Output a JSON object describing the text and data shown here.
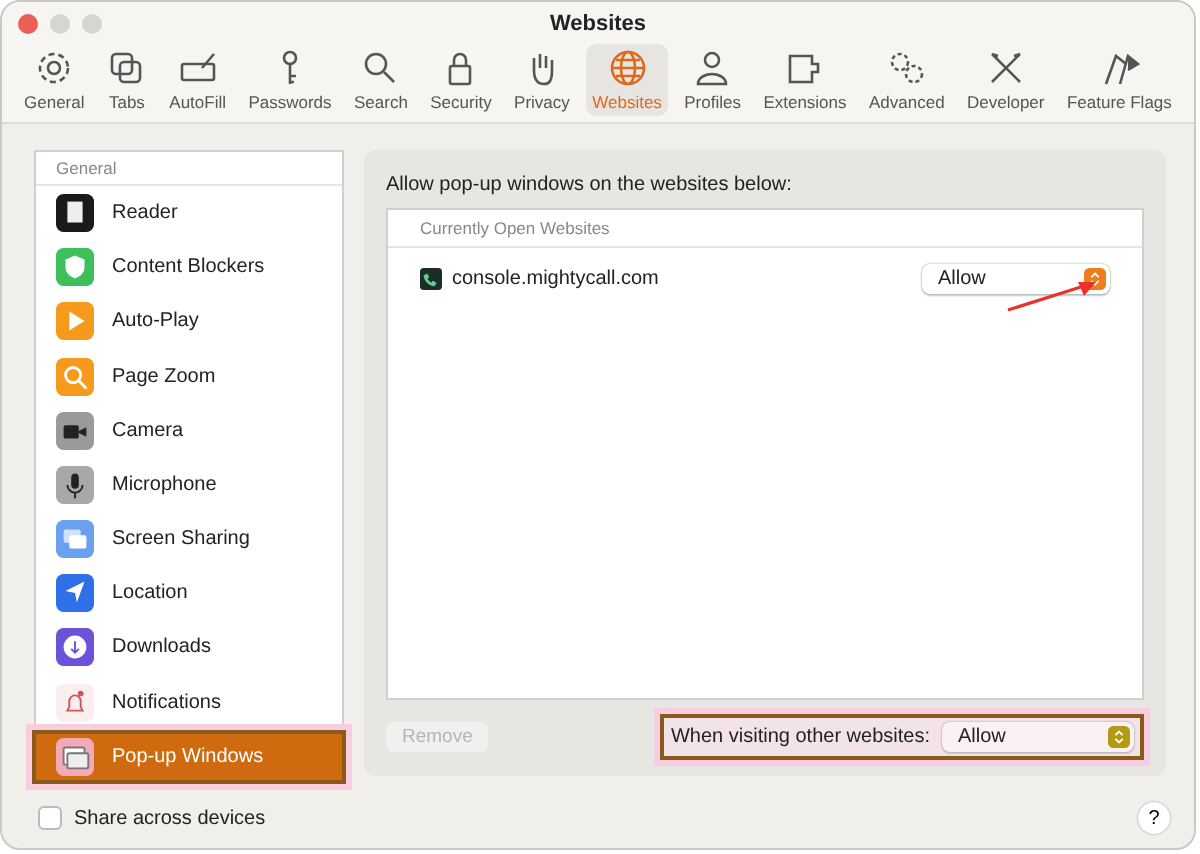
{
  "window": {
    "title": "Websites"
  },
  "toolbar": [
    {
      "label": "General",
      "selected": false
    },
    {
      "label": "Tabs",
      "selected": false
    },
    {
      "label": "AutoFill",
      "selected": false
    },
    {
      "label": "Passwords",
      "selected": false
    },
    {
      "label": "Search",
      "selected": false
    },
    {
      "label": "Security",
      "selected": false
    },
    {
      "label": "Privacy",
      "selected": false
    },
    {
      "label": "Websites",
      "selected": true
    },
    {
      "label": "Profiles",
      "selected": false
    },
    {
      "label": "Extensions",
      "selected": false
    },
    {
      "label": "Advanced",
      "selected": false
    },
    {
      "label": "Developer",
      "selected": false
    },
    {
      "label": "Feature Flags",
      "selected": false
    }
  ],
  "sidebar": {
    "header": "General",
    "items": [
      {
        "label": "Reader",
        "selected": false
      },
      {
        "label": "Content Blockers",
        "selected": false
      },
      {
        "label": "Auto-Play",
        "selected": false
      },
      {
        "label": "Page Zoom",
        "selected": false
      },
      {
        "label": "Camera",
        "selected": false
      },
      {
        "label": "Microphone",
        "selected": false
      },
      {
        "label": "Screen Sharing",
        "selected": false
      },
      {
        "label": "Location",
        "selected": false
      },
      {
        "label": "Downloads",
        "selected": false
      },
      {
        "label": "Notifications",
        "selected": false
      },
      {
        "label": "Pop-up Windows",
        "selected": true
      }
    ]
  },
  "panel": {
    "caption": "Allow pop-up windows on the websites below:",
    "table_header": "Currently Open Websites",
    "sites": [
      {
        "domain": "console.mightycall.com",
        "setting": "Allow"
      }
    ],
    "remove_button": {
      "label": "Remove",
      "disabled": true
    },
    "default": {
      "label": "When visiting other websites:",
      "setting": "Allow"
    }
  },
  "share": {
    "label": "Share across devices",
    "checked": false
  },
  "help": "?"
}
